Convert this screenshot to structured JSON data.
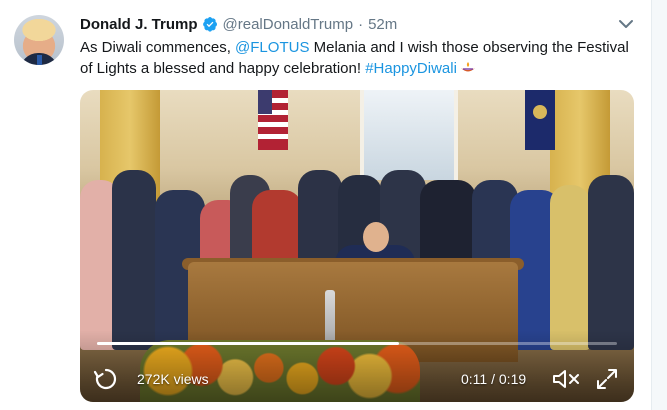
{
  "tweet": {
    "author_name": "Donald J. Trump",
    "handle": "@realDonaldTrump",
    "separator": "·",
    "timestamp": "52m",
    "text_parts": {
      "before_mention": "As Diwali commences, ",
      "mention": "@FLOTUS",
      "middle": " Melania and I wish those observing the Festival of Lights a blessed and happy celebration! ",
      "hashtag": "#HappyDiwali"
    },
    "icons": {
      "verified": "verified-badge-icon",
      "caret": "chevron-down-icon",
      "emoji": "diya-lamp-emoji-icon"
    }
  },
  "video": {
    "views_label": "272K views",
    "current_time": "0:11",
    "time_separator": " / ",
    "duration": "0:19",
    "progress_fraction": 0.58,
    "icons": {
      "replay": "replay-icon",
      "mute": "muted-speaker-icon",
      "fullscreen": "fullscreen-icon"
    }
  },
  "colors": {
    "link": "#1b95e0",
    "verified": "#1da1f2",
    "secondary_text": "#657786",
    "primary_text": "#14171a"
  }
}
